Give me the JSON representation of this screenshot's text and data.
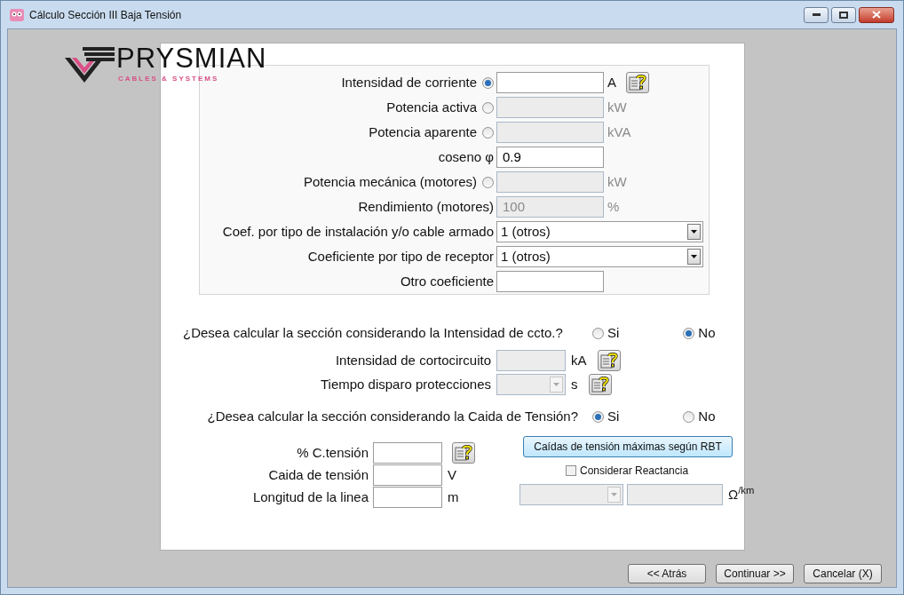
{
  "window": {
    "title": "Cálculo Sección III Baja Tensión"
  },
  "logo": {
    "name": "PRYSMIAN",
    "tagline": "CABLES & SYSTEMS"
  },
  "load_group": [
    {
      "kind": "radio_field",
      "label": "Intensidad de corriente",
      "selected": true,
      "disabled": false,
      "unit": "A",
      "help": true
    },
    {
      "kind": "radio_field",
      "label": "Potencia activa",
      "selected": false,
      "disabled": true,
      "unit": "kW"
    },
    {
      "kind": "radio_field",
      "label": "Potencia aparente",
      "selected": false,
      "disabled": true,
      "unit": "kVA"
    },
    {
      "kind": "field",
      "label": "coseno φ",
      "value": "0.9",
      "disabled": false
    },
    {
      "kind": "radio_field",
      "label": "Potencia mecánica (motores)",
      "selected": false,
      "disabled": true,
      "unit": "kW"
    },
    {
      "kind": "field",
      "label": "Rendimiento (motores)",
      "value": "100",
      "disabled": true,
      "unit": "%"
    },
    {
      "kind": "select",
      "label": "Coef. por tipo de instalación y/o cable armado",
      "value": "1 (otros)"
    },
    {
      "kind": "select",
      "label": "Coeficiente por tipo de receptor",
      "value": "1 (otros)"
    },
    {
      "kind": "field",
      "label": "Otro coeficiente",
      "disabled": false
    }
  ],
  "short_circuit": {
    "question": "¿Desea calcular la sección considerando la Intensidad de ccto.?",
    "options": [
      {
        "label": "Si",
        "selected": false
      },
      {
        "label": "No",
        "selected": true
      }
    ],
    "rows": [
      {
        "kind": "field",
        "label": "Intensidad de cortocircuito",
        "unit": "kA",
        "disabled": true
      },
      {
        "kind": "combo",
        "label": "Tiempo disparo protecciones",
        "unit": "s",
        "disabled": true
      }
    ]
  },
  "voltage_drop": {
    "question": "¿Desea calcular la sección considerando la Caida de Tensión?",
    "options": [
      {
        "label": "Si",
        "selected": true
      },
      {
        "label": "No",
        "selected": false
      }
    ],
    "rows": [
      {
        "label": "% C.tensión",
        "help": true
      },
      {
        "label": "Caida de tensión",
        "unit": "V"
      },
      {
        "label": "Longitud de la linea",
        "unit": "m"
      }
    ],
    "button": "Caídas de tensión máximas según RBT",
    "reactance": {
      "label": "Considerar Reactancia",
      "checked": false
    },
    "reactance_unit": "Ω$^{/km}$"
  },
  "buttons": [
    "<< Atrás",
    "Continuar >>",
    "Cancelar (X)"
  ]
}
